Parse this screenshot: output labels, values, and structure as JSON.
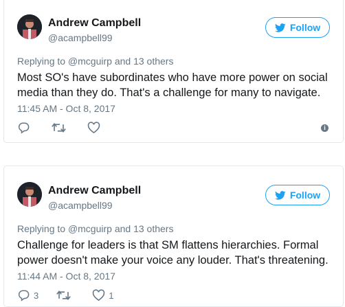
{
  "tweets": [
    {
      "author": "Andrew Campbell",
      "handle": "@acampbell99",
      "follow_label": "Follow",
      "reply_prefix": "Replying to",
      "reply_to": "@mcguirp",
      "reply_suffix": "and 13 others",
      "text": "Most SO's have subordinates who have more power on social media than they do. That's a challenge for many to navigate.",
      "timestamp": "11:45 AM - Oct 8, 2017",
      "reply_count": "",
      "retweet_count": "",
      "like_count": ""
    },
    {
      "author": "Andrew Campbell",
      "handle": "@acampbell99",
      "follow_label": "Follow",
      "reply_prefix": "Replying to",
      "reply_to": "@mcguirp",
      "reply_suffix": "and 13 others",
      "text": "Challenge for leaders is that SM flattens hierarchies. Formal power doesn't make your voice any louder. That's threatening.",
      "timestamp": "11:44 AM - Oct 8, 2017",
      "reply_count": "3",
      "retweet_count": "",
      "like_count": "1"
    }
  ],
  "colors": {
    "accent": "#1da1f2",
    "muted": "#657786",
    "text": "#14171a",
    "border": "#e1e8ed"
  },
  "icons": [
    "bird-icon",
    "reply-icon",
    "retweet-icon",
    "like-icon",
    "info-icon"
  ]
}
